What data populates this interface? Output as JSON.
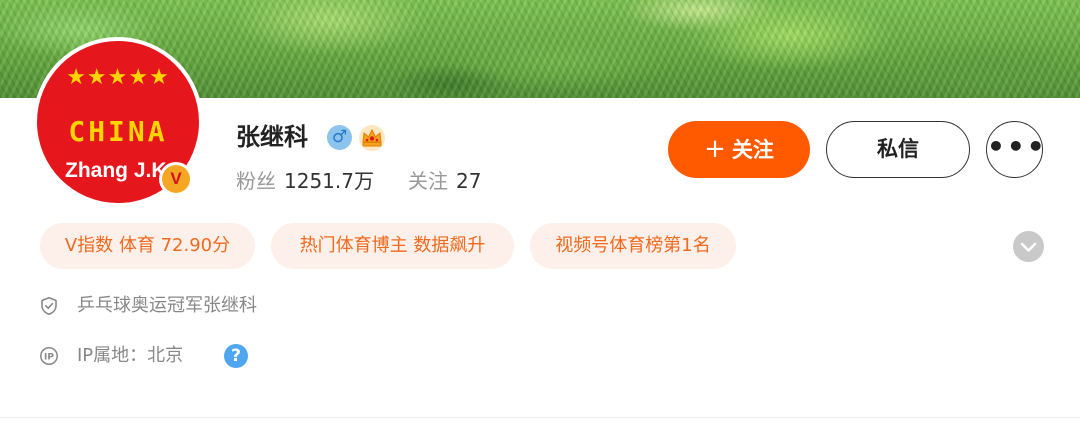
{
  "profile": {
    "name": "张继科",
    "gender_icon": "male-icon",
    "gender_symbol": "♂",
    "badge_icon": "crown-icon",
    "avatar": {
      "stars": "★★★★★",
      "line1": "CHINA",
      "line2": "Zhang J.K",
      "verified_badge": "V"
    },
    "stats": {
      "followers_label": "粉丝",
      "followers_value": "1251.7万",
      "following_label": "关注",
      "following_value": "27"
    }
  },
  "actions": {
    "follow_icon": "+",
    "follow_label": "关注",
    "message_label": "私信",
    "more_label": "•••"
  },
  "tags": [
    "V指数 体育 72.90分",
    "热门体育博主 数据飙升",
    "视频号体育榜第1名"
  ],
  "info": {
    "verification": "乒乓球奥运冠军张继科",
    "ip_location": "IP属地：北京",
    "help_symbol": "?"
  },
  "colors": {
    "accent": "#ff5a00",
    "tag_bg": "#fdf0ea",
    "tag_text": "#f06a1e",
    "avatar_red": "#e5161c",
    "avatar_gold": "#ffd400"
  }
}
